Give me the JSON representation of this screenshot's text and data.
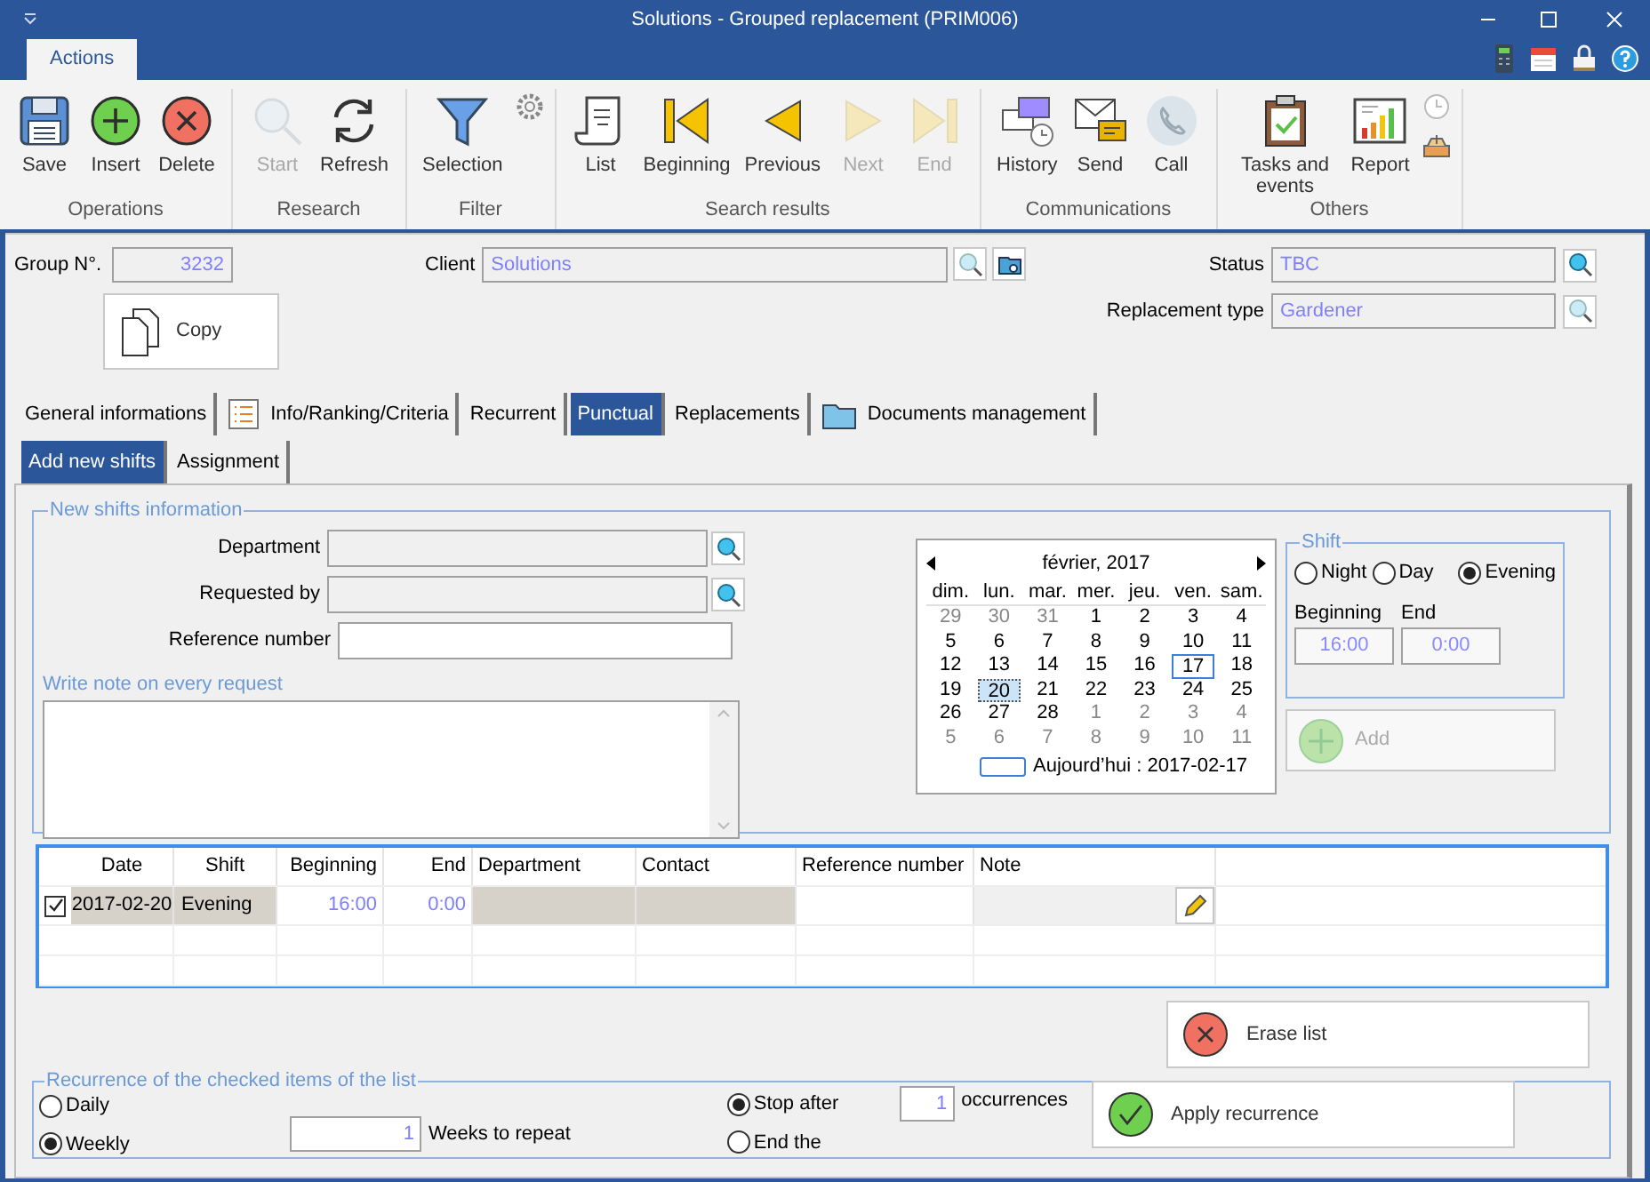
{
  "window": {
    "title": "Solutions - Grouped replacement (PRIM006)"
  },
  "ribbon": {
    "tabs": [
      {
        "label": "Actions",
        "selected": true
      }
    ],
    "groups": [
      {
        "label": "Operations",
        "buttons": [
          {
            "label": "Save",
            "disabled": false
          },
          {
            "label": "Insert",
            "disabled": false
          },
          {
            "label": "Delete",
            "disabled": false
          }
        ]
      },
      {
        "label": "Research",
        "buttons": [
          {
            "label": "Start",
            "disabled": true
          },
          {
            "label": "Refresh",
            "disabled": false
          }
        ]
      },
      {
        "label": "Filter",
        "buttons": [
          {
            "label": "Selection",
            "disabled": false
          }
        ]
      },
      {
        "label": "Search results",
        "buttons": [
          {
            "label": "List",
            "disabled": false
          },
          {
            "label": "Beginning",
            "disabled": false
          },
          {
            "label": "Previous",
            "disabled": false
          },
          {
            "label": "Next",
            "disabled": true
          },
          {
            "label": "End",
            "disabled": true
          }
        ]
      },
      {
        "label": "Communications",
        "buttons": [
          {
            "label": "History",
            "disabled": false
          },
          {
            "label": "Send",
            "disabled": false
          },
          {
            "label": "Call",
            "disabled": false
          }
        ]
      },
      {
        "label": "Others",
        "buttons": [
          {
            "label": "Tasks and events",
            "disabled": false
          },
          {
            "label": "Report",
            "disabled": false
          }
        ]
      }
    ]
  },
  "header": {
    "group_no": {
      "label": "Group N°.",
      "value": "3232"
    },
    "copy_button": "Copy",
    "client": {
      "label": "Client",
      "value": "Solutions"
    },
    "status": {
      "label": "Status",
      "value": "TBC"
    },
    "replacement_type": {
      "label": "Replacement type",
      "value": "Gardener"
    }
  },
  "tabs": [
    {
      "label": "General informations",
      "selected": false
    },
    {
      "label": "Info/Ranking/Criteria",
      "selected": false
    },
    {
      "label": "Recurrent",
      "selected": false
    },
    {
      "label": "Punctual",
      "selected": true
    },
    {
      "label": "Replacements",
      "selected": false
    },
    {
      "label": "Documents management",
      "selected": false
    }
  ],
  "subtabs": [
    {
      "label": "Add new shifts",
      "selected": true
    },
    {
      "label": "Assignment",
      "selected": false
    }
  ],
  "new_shifts": {
    "legend": "New shifts information",
    "fields": [
      {
        "label": "Department",
        "kind": "lookup"
      },
      {
        "label": "Requested by",
        "kind": "lookup"
      },
      {
        "label": "Reference number",
        "kind": "text"
      }
    ],
    "note_label": "Write note on every request"
  },
  "calendar": {
    "month": "février, 2017",
    "weekdays": [
      "dim.",
      "lun.",
      "mar.",
      "mer.",
      "jeu.",
      "ven.",
      "sam."
    ],
    "weeks": [
      [
        {
          "day": "29",
          "outside": true,
          "selected": false,
          "today": false
        },
        {
          "day": "30",
          "outside": true,
          "selected": false,
          "today": false
        },
        {
          "day": "31",
          "outside": true,
          "selected": false,
          "today": false
        },
        {
          "day": "1",
          "outside": false,
          "selected": false,
          "today": false
        },
        {
          "day": "2",
          "outside": false,
          "selected": false,
          "today": false
        },
        {
          "day": "3",
          "outside": false,
          "selected": false,
          "today": false
        },
        {
          "day": "4",
          "outside": false,
          "selected": false,
          "today": false
        }
      ],
      [
        {
          "day": "5",
          "outside": false,
          "selected": false,
          "today": false
        },
        {
          "day": "6",
          "outside": false,
          "selected": false,
          "today": false
        },
        {
          "day": "7",
          "outside": false,
          "selected": false,
          "today": false
        },
        {
          "day": "8",
          "outside": false,
          "selected": false,
          "today": false
        },
        {
          "day": "9",
          "outside": false,
          "selected": false,
          "today": false
        },
        {
          "day": "10",
          "outside": false,
          "selected": false,
          "today": false
        },
        {
          "day": "11",
          "outside": false,
          "selected": false,
          "today": false
        }
      ],
      [
        {
          "day": "12",
          "outside": false,
          "selected": false,
          "today": false
        },
        {
          "day": "13",
          "outside": false,
          "selected": false,
          "today": false
        },
        {
          "day": "14",
          "outside": false,
          "selected": false,
          "today": false
        },
        {
          "day": "15",
          "outside": false,
          "selected": false,
          "today": false
        },
        {
          "day": "16",
          "outside": false,
          "selected": false,
          "today": false
        },
        {
          "day": "17",
          "outside": false,
          "selected": false,
          "today": true
        },
        {
          "day": "18",
          "outside": false,
          "selected": false,
          "today": false
        }
      ],
      [
        {
          "day": "19",
          "outside": false,
          "selected": false,
          "today": false
        },
        {
          "day": "20",
          "outside": false,
          "selected": true,
          "today": false
        },
        {
          "day": "21",
          "outside": false,
          "selected": false,
          "today": false
        },
        {
          "day": "22",
          "outside": false,
          "selected": false,
          "today": false
        },
        {
          "day": "23",
          "outside": false,
          "selected": false,
          "today": false
        },
        {
          "day": "24",
          "outside": false,
          "selected": false,
          "today": false
        },
        {
          "day": "25",
          "outside": false,
          "selected": false,
          "today": false
        }
      ],
      [
        {
          "day": "26",
          "outside": false,
          "selected": false,
          "today": false
        },
        {
          "day": "27",
          "outside": false,
          "selected": false,
          "today": false
        },
        {
          "day": "28",
          "outside": false,
          "selected": false,
          "today": false
        },
        {
          "day": "1",
          "outside": true,
          "selected": false,
          "today": false
        },
        {
          "day": "2",
          "outside": true,
          "selected": false,
          "today": false
        },
        {
          "day": "3",
          "outside": true,
          "selected": false,
          "today": false
        },
        {
          "day": "4",
          "outside": true,
          "selected": false,
          "today": false
        }
      ],
      [
        {
          "day": "5",
          "outside": true,
          "selected": false,
          "today": false
        },
        {
          "day": "6",
          "outside": true,
          "selected": false,
          "today": false
        },
        {
          "day": "7",
          "outside": true,
          "selected": false,
          "today": false
        },
        {
          "day": "8",
          "outside": true,
          "selected": false,
          "today": false
        },
        {
          "day": "9",
          "outside": true,
          "selected": false,
          "today": false
        },
        {
          "day": "10",
          "outside": true,
          "selected": false,
          "today": false
        },
        {
          "day": "11",
          "outside": true,
          "selected": false,
          "today": false
        }
      ]
    ],
    "today_label": "Aujourd’hui : 2017-02-17"
  },
  "shift": {
    "legend": "Shift",
    "options": [
      {
        "label": "Night",
        "selected": false
      },
      {
        "label": "Day",
        "selected": false
      },
      {
        "label": "Evening",
        "selected": true
      }
    ],
    "beginning": {
      "label": "Beginning",
      "value": "16:00"
    },
    "end": {
      "label": "End",
      "value": "0:00"
    }
  },
  "add_button": {
    "label": "Add",
    "disabled": true
  },
  "grid": {
    "columns": [
      "Date",
      "Shift",
      "Beginning",
      "End",
      "Department",
      "Contact",
      "Reference number",
      "Note"
    ],
    "rows": [
      {
        "checked": true,
        "date": "2017-02-20",
        "shift": "Evening",
        "beginning": "16:00",
        "end": "0:00"
      }
    ]
  },
  "erase_button": "Erase list",
  "recurrence": {
    "legend": "Recurrence of the checked items of the list",
    "frequency": [
      {
        "label": "Daily",
        "selected": false
      },
      {
        "label": "Weekly",
        "selected": true
      }
    ],
    "weeks": {
      "value": "1",
      "label": "Weeks to repeat"
    },
    "stop": [
      {
        "label": "Stop after",
        "selected": true
      },
      {
        "label": "End the",
        "selected": false
      }
    ],
    "occurrences": {
      "value": "1",
      "label": "occurrences"
    },
    "apply_button": "Apply recurrence"
  }
}
